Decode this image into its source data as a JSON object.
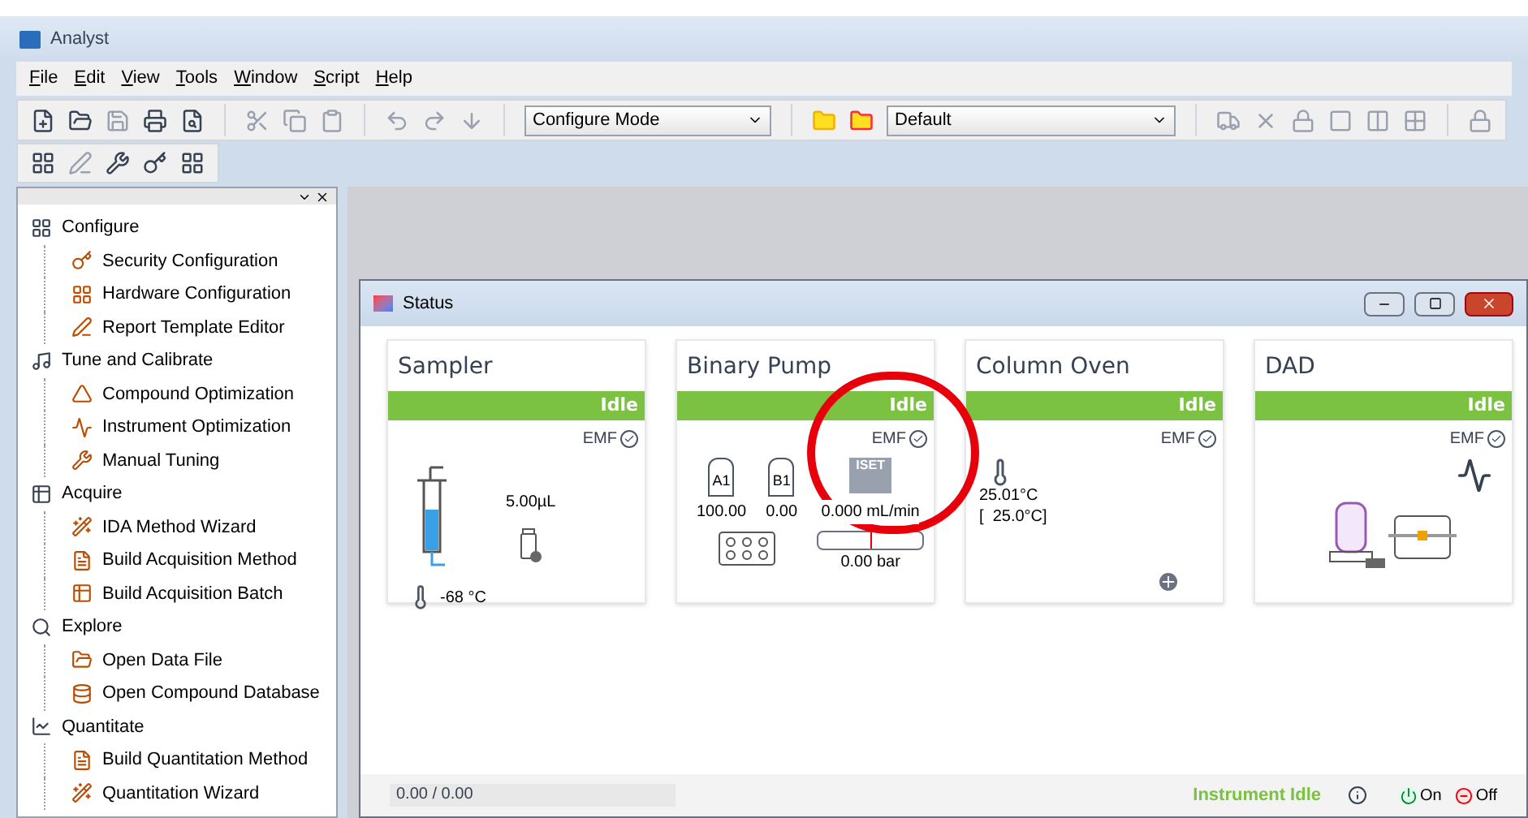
{
  "window": {
    "title": "Analyst"
  },
  "menu": [
    "File",
    "Edit",
    "View",
    "Tools",
    "Window",
    "Script",
    "Help"
  ],
  "toolbar": {
    "mode_select": "Configure Mode",
    "project_select": "Default"
  },
  "sidebar": {
    "items": [
      {
        "label": "Configure",
        "children": [
          {
            "label": "Security Configuration"
          },
          {
            "label": "Hardware Configuration"
          },
          {
            "label": "Report Template Editor"
          }
        ]
      },
      {
        "label": "Tune and Calibrate",
        "children": [
          {
            "label": "Compound Optimization"
          },
          {
            "label": "Instrument Optimization"
          },
          {
            "label": "Manual Tuning"
          }
        ]
      },
      {
        "label": "Acquire",
        "children": [
          {
            "label": "IDA Method Wizard"
          },
          {
            "label": "Build Acquisition Method"
          },
          {
            "label": "Build Acquisition Batch"
          }
        ]
      },
      {
        "label": "Explore",
        "children": [
          {
            "label": "Open Data File"
          },
          {
            "label": "Open Compound Database"
          }
        ]
      },
      {
        "label": "Quantitate",
        "children": [
          {
            "label": "Build Quantitation Method"
          },
          {
            "label": "Quantitation Wizard"
          }
        ]
      }
    ]
  },
  "status_window": {
    "title": "Status",
    "modules": [
      {
        "kind": "sampler",
        "name": "Sampler",
        "status": "Idle",
        "emf": "EMF",
        "volume": "5.00µL",
        "temperature": "-68 °C"
      },
      {
        "kind": "pump",
        "name": "Binary Pump",
        "status": "Idle",
        "emf": "EMF",
        "solvents": [
          {
            "label": "A1",
            "value": "100.00"
          },
          {
            "label": "B1",
            "value": "0.00"
          }
        ],
        "iset": "ISET",
        "flow": "0.000 mL/min",
        "pressure": "0.00 bar"
      },
      {
        "kind": "oven",
        "name": "Column Oven",
        "status": "Idle",
        "emf": "EMF",
        "temperature": "25.01°C",
        "setpoint": "[  25.0°C]"
      },
      {
        "kind": "dad",
        "name": "DAD",
        "status": "Idle",
        "emf": "EMF"
      }
    ],
    "status_bar": {
      "progress": "0.00 / 0.00",
      "state": "Instrument Idle",
      "on": "On",
      "off": "Off"
    }
  }
}
